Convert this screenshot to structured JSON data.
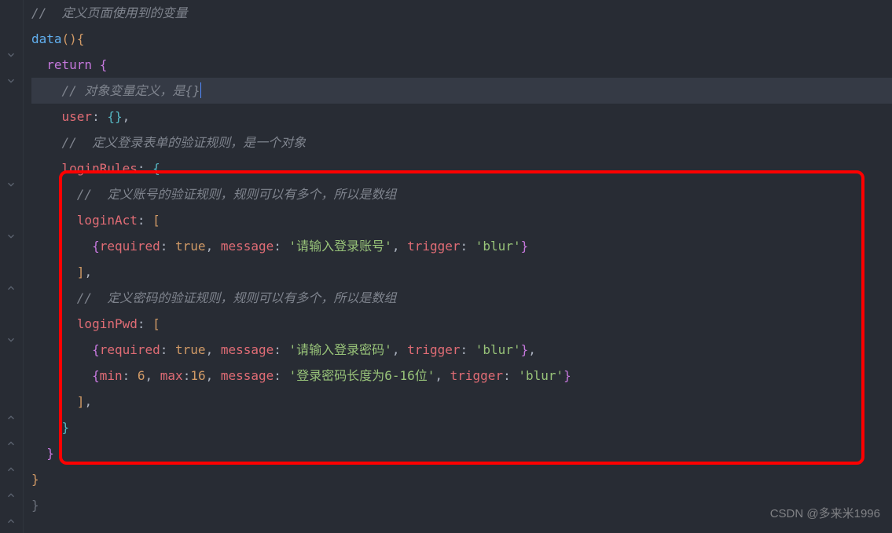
{
  "lines": {
    "l1_comment": "//  定义页面使用到的变量",
    "l2_func": "data",
    "l2_paren": "(){",
    "l3_return": "return",
    "l3_brace": " {",
    "l4_comment": "// 对象变量定义，是{}",
    "l5_prop": "user",
    "l5_rest": ": {},",
    "l6_comment": "//  定义登录表单的验证规则，是一个对象",
    "l7_prop": "loginRules",
    "l7_rest": ": {",
    "l8_comment": "//  定义账号的验证规则，规则可以有多个，所以是数组",
    "l9_prop": "loginAct",
    "l9_rest": ": [",
    "l10_required": "required",
    "l10_true": "true",
    "l10_message": "message",
    "l10_msgval": "'请输入登录账号'",
    "l10_trigger": "trigger",
    "l10_blur": "'blur'",
    "l11_close": "],",
    "l12_comment": "//  定义密码的验证规则，规则可以有多个，所以是数组",
    "l13_prop": "loginPwd",
    "l13_rest": ": [",
    "l14_required": "required",
    "l14_true": "true",
    "l14_message": "message",
    "l14_msgval": "'请输入登录密码'",
    "l14_trigger": "trigger",
    "l14_blur": "'blur'",
    "l15_min": "min",
    "l15_minval": "6",
    "l15_max": "max",
    "l15_maxval": "16",
    "l15_message": "message",
    "l15_msgval": "'登录密码长度为6-16位'",
    "l15_trigger": "trigger",
    "l15_blur": "'blur'",
    "l16_close": "],",
    "l17_brace": "}",
    "l18_brace": "}",
    "l19_brace": "}",
    "l20_brace": "}"
  },
  "watermark": "CSDN @多来米1996"
}
